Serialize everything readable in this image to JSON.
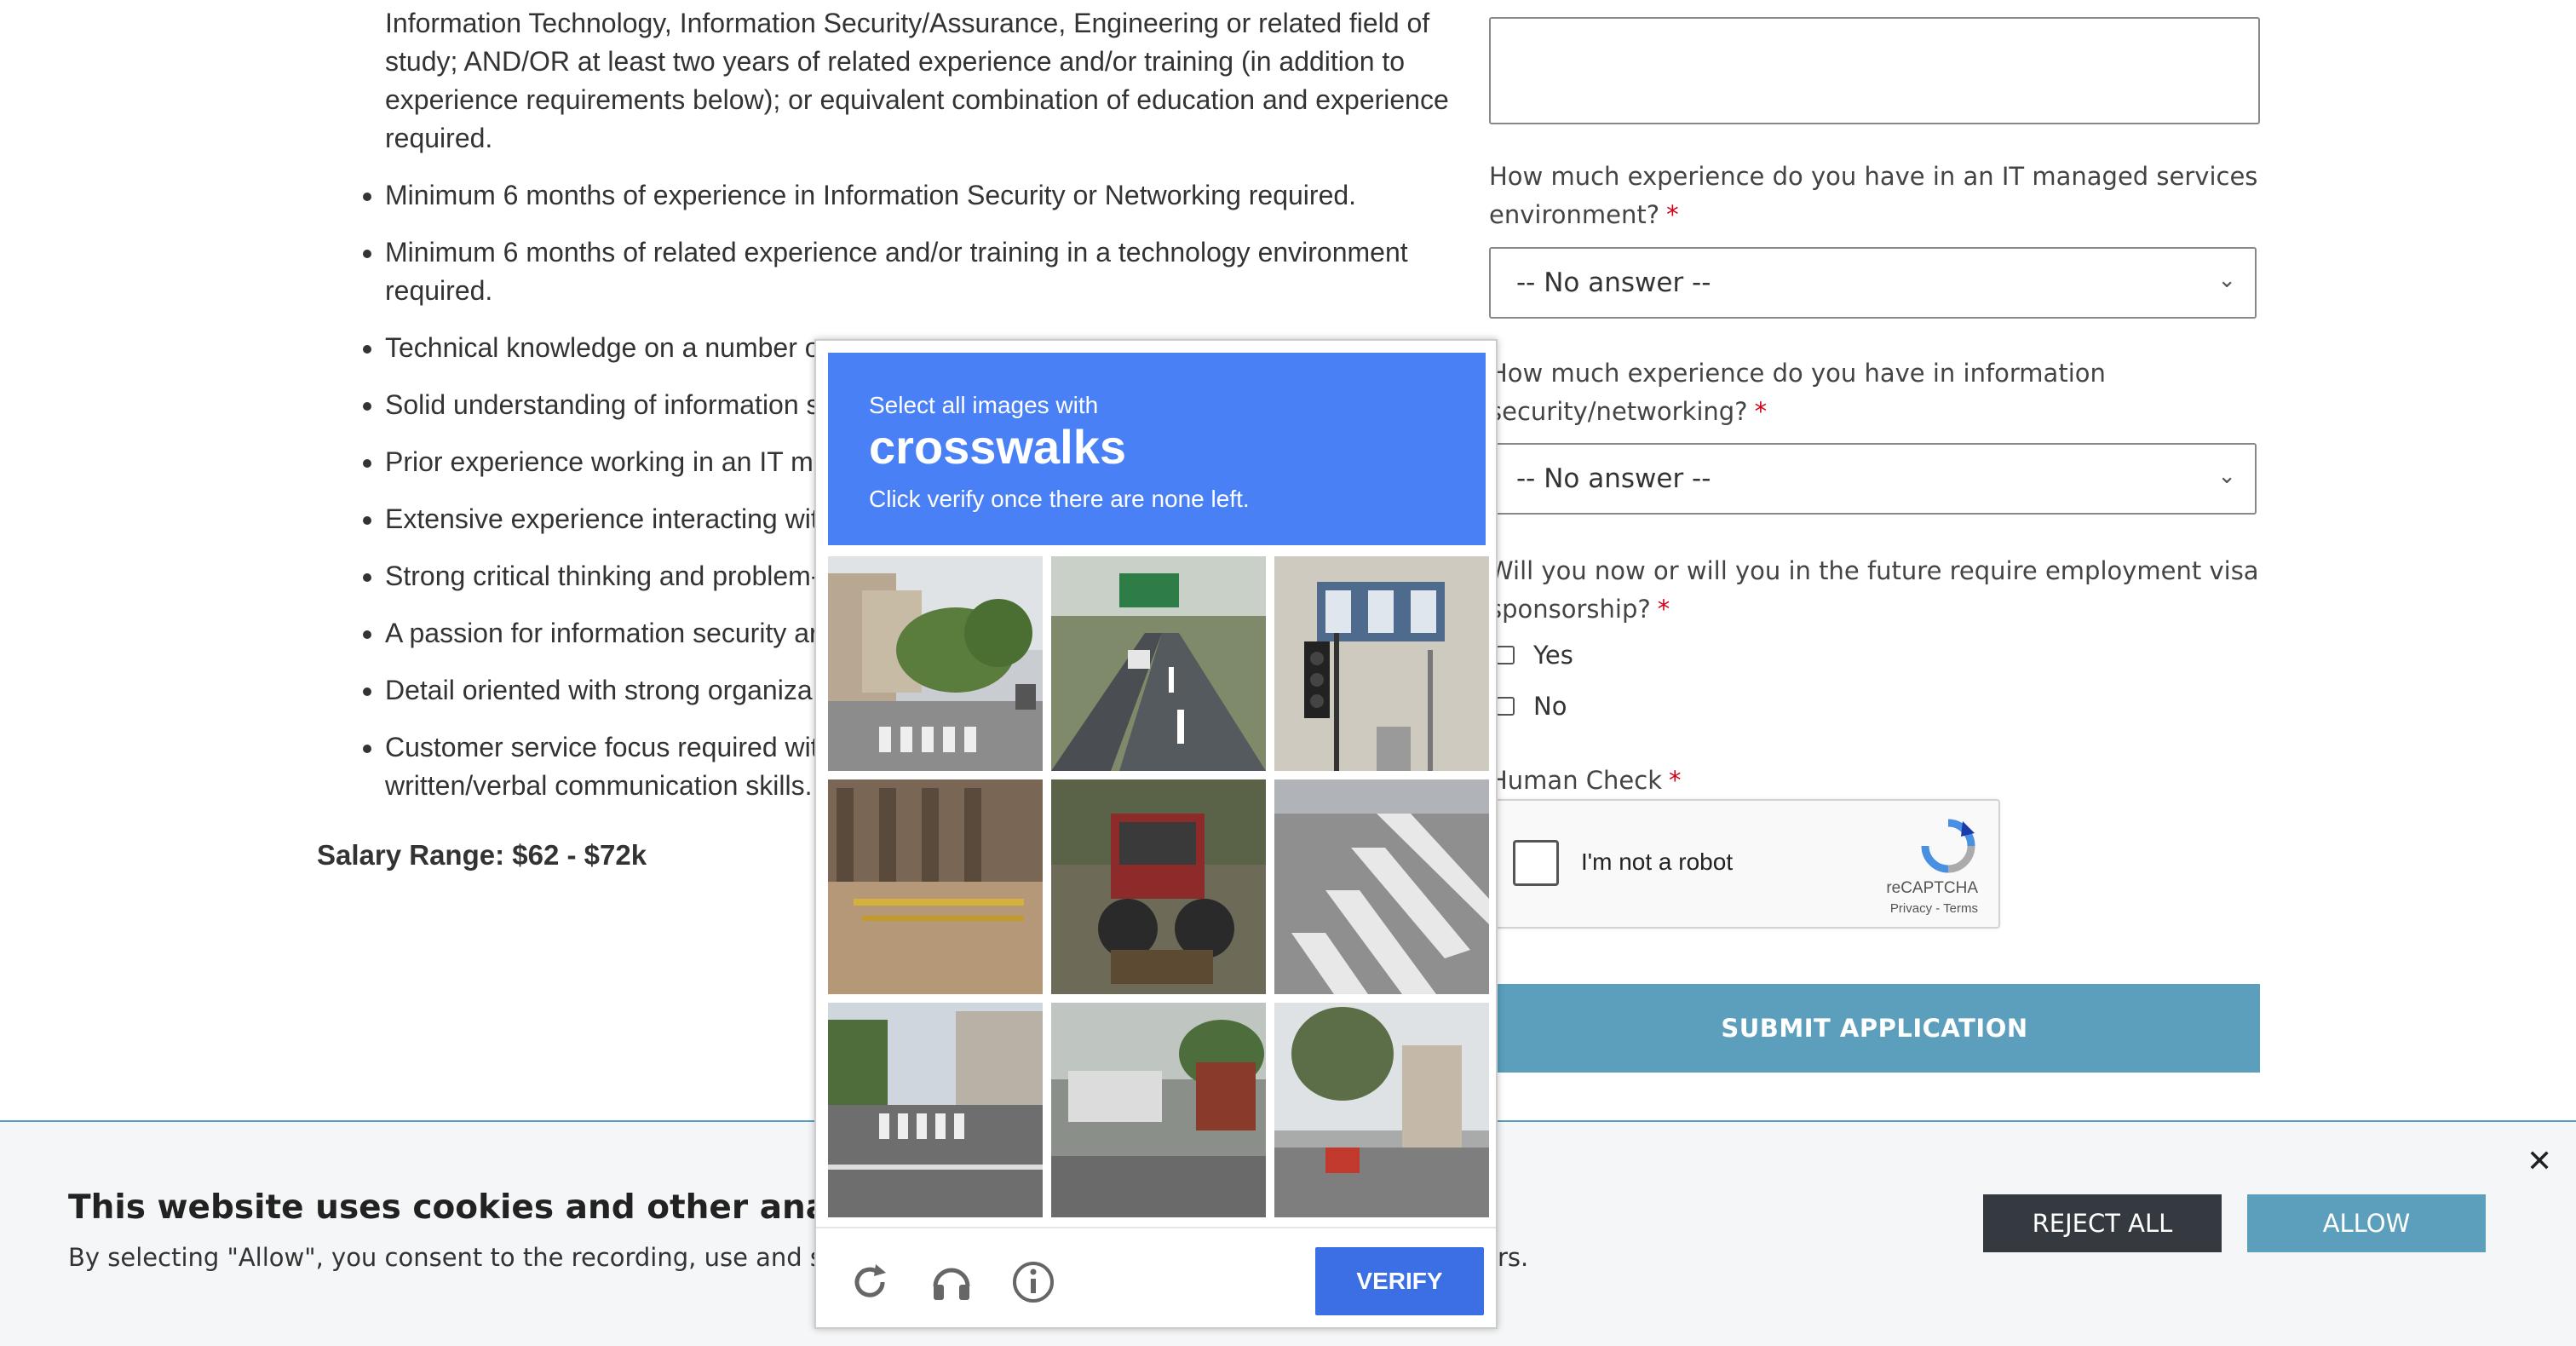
{
  "job": {
    "bullets": [
      "Associate's Degree or equivalent from two-year college or technical school in Information Technology, Information Security/Assurance, Engineering or related field of study; AND/OR at least two years of related experience and/or training (in addition to experience requirements below); or equivalent combination of education and experience required.",
      "Minimum 6 months of experience in Information Security or Networking required.",
      "Minimum 6 months of related experience and/or training in a technology environment required.",
      "Technical knowledge on a number o",
      "Solid understanding of information s",
      "Prior experience working in an IT m",
      "Extensive experience interacting wit",
      "Strong critical thinking and problem-",
      "A passion for information security ar",
      "Detail oriented with strong organiza",
      "Customer service focus required wit written/verbal communication skills."
    ],
    "salary": "Salary Range: $62 - $72k"
  },
  "form": {
    "q1_label": "How much experience do you have in an IT managed services environment?",
    "q1_value": "-- No answer --",
    "q2_label": "How much experience do you have in information security/networking?",
    "q2_value": "-- No answer --",
    "q3_label": "Will you now or will you in the future require employment visa sponsorship?",
    "q3_options": [
      "Yes",
      "No"
    ],
    "required_mark": "*",
    "human_check_label": "Human Check",
    "recaptcha_text": "I'm not a robot",
    "recaptcha_brand": "reCAPTCHA",
    "recaptcha_terms": "Privacy - Terms",
    "submit_label": "SUBMIT APPLICATION"
  },
  "cookie_banner": {
    "title": "This website uses cookies and other analytics techn",
    "body": "By selecting \"Allow\", you consent to the recording, use and sharing",
    "body_tail": "rs.",
    "reject_label": "REJECT ALL",
    "allow_label": "ALLOW",
    "close_icon": "close-icon"
  },
  "challenge": {
    "instruction_line1": "Select all images with",
    "target": "crosswalks",
    "instruction_line3": "Click verify once there are none left.",
    "verify_label": "VERIFY",
    "footer_icons": [
      "reload-icon",
      "audio-icon",
      "info-icon"
    ],
    "tiles": [
      "street-with-crosswalk",
      "highway-road",
      "traffic-light-building",
      "bicycle-rack",
      "tractor",
      "crosswalk-closeup",
      "intersection-crosswalk",
      "street-with-bus",
      "street-with-trees"
    ]
  },
  "colors": {
    "accent": "#5b9fbc",
    "captcha_blue": "#4a80f5",
    "verify_blue": "#3b6fe3",
    "required": "#d0021b",
    "reject_dark": "#343a40"
  }
}
